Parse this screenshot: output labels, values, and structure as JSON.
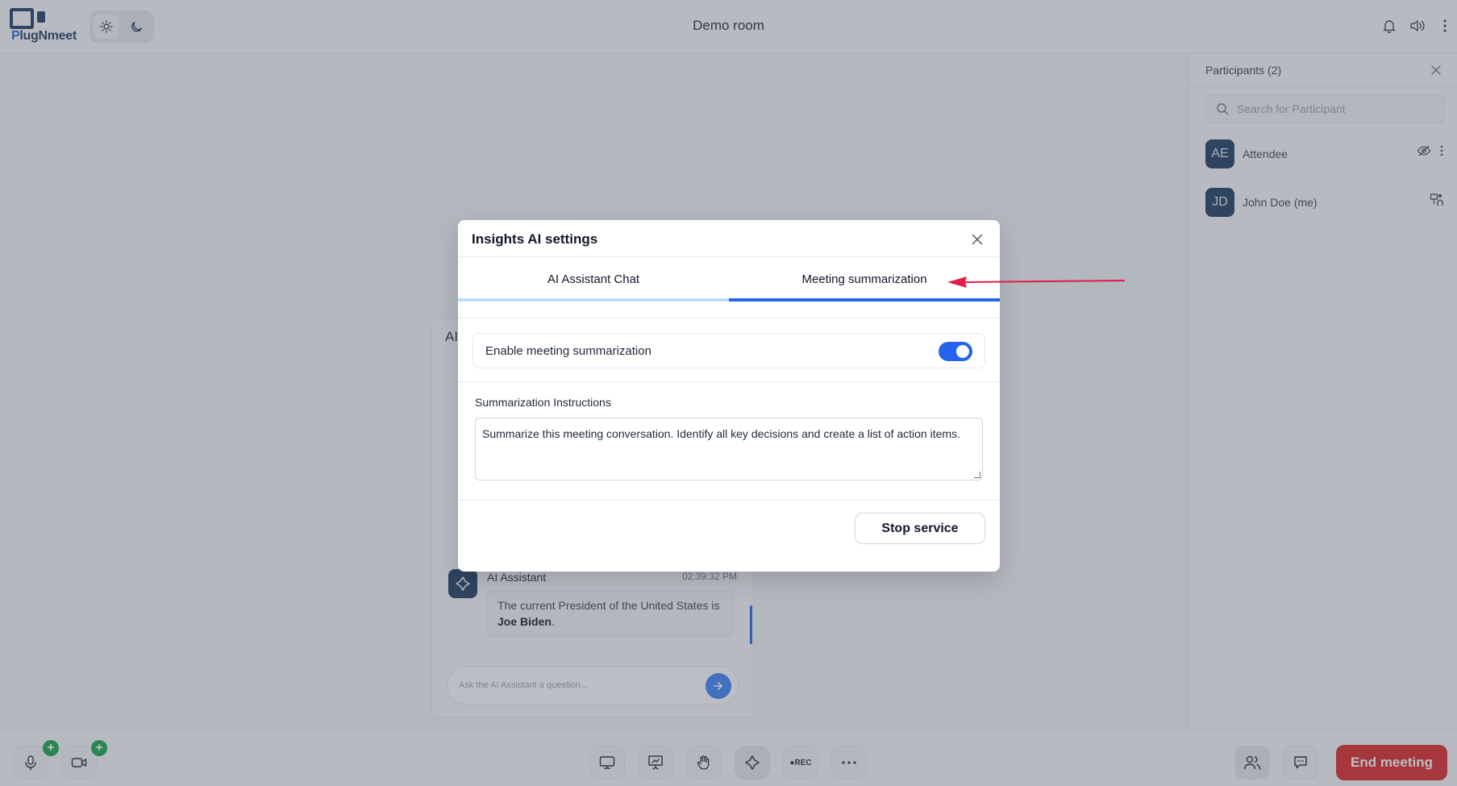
{
  "header": {
    "logo_text_main": "lugNmeet",
    "logo_text_prefix": "P",
    "room_title": "Demo room",
    "icons": [
      "bell-icon",
      "speaker-icon",
      "more-vertical-icon"
    ]
  },
  "theme": {
    "light_icon": "sun-icon",
    "dark_icon": "moon-icon"
  },
  "ai_panel": {
    "title": "AI",
    "message": {
      "sender": "AI Assistant",
      "time": "02:39:32 PM",
      "text_before": "The current President of the United States is ",
      "text_bold": "Joe Biden",
      "text_after": "."
    },
    "input_placeholder": "Ask the AI Assistant a question..."
  },
  "participants": {
    "title": "Participants (2)",
    "search_placeholder": "Search for Participant",
    "items": [
      {
        "initials": "AE",
        "name": "Attendee"
      },
      {
        "initials": "JD",
        "name": "John Doe (me)"
      }
    ]
  },
  "footer": {
    "rec_label": "●REC",
    "end_meeting_label": "End meeting",
    "plus_badge": "+"
  },
  "modal": {
    "title": "Insights AI settings",
    "tabs": [
      {
        "label": "AI Assistant Chat",
        "active": false
      },
      {
        "label": "Meeting summarization",
        "active": true
      }
    ],
    "enable_label": "Enable meeting summarization",
    "enable_value": true,
    "instructions_label": "Summarization Instructions",
    "instructions_value": "Summarize this meeting conversation. Identify all key decisions and create a list of action items.",
    "stop_button": "Stop service"
  },
  "colors": {
    "accent": "#2563eb",
    "brand_dark": "#1e3a5f",
    "danger": "#dc2626",
    "annotation": "#e11d48"
  }
}
